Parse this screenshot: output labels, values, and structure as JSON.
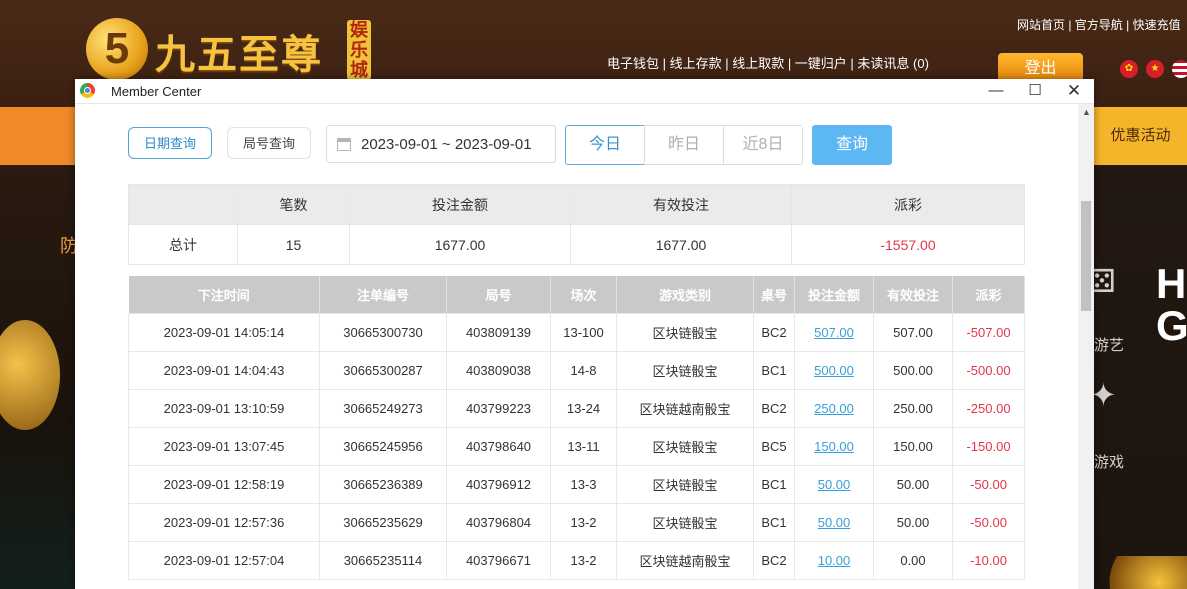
{
  "site": {
    "logo_number": "5",
    "logo_text": "九五至尊",
    "logo_tag": "娱乐城",
    "top_links": "网站首页 | 官方导航 | 快速充值",
    "wallet_links": "电子钱包 | 线上存款 | 线上取款 | 一键归户 | 未读讯息 (0)",
    "logout_label": "登出",
    "promo_label": "优惠活动",
    "left_text": "防",
    "side_label_1": "游艺",
    "side_label_2": "游戏",
    "side_big": "HO GA"
  },
  "window": {
    "title": "Member Center",
    "min_label": "—",
    "max_label": "☐",
    "close_label": "✕"
  },
  "toolbar": {
    "tab_date": "日期查询",
    "tab_round": "局号查询",
    "date_range": "2023-09-01 ~ 2023-09-01",
    "quick_today": "今日",
    "quick_yesterday": "昨日",
    "quick_8days": "近8日",
    "query_label": "查询"
  },
  "summary": {
    "headers": [
      "",
      "笔数",
      "投注金额",
      "有效投注",
      "派彩"
    ],
    "row": {
      "label": "总计",
      "count": "15",
      "bet": "1677.00",
      "valid": "1677.00",
      "payout": "-1557.00"
    }
  },
  "detail": {
    "headers": [
      "下注时间",
      "注单编号",
      "局号",
      "场次",
      "游戏类别",
      "桌号",
      "投注金额",
      "有效投注",
      "派彩"
    ],
    "rows": [
      [
        "2023-09-01 14:05:14",
        "30665300730",
        "403809139",
        "13-100",
        "区块链骰宝",
        "BC2",
        "507.00",
        "507.00",
        "-507.00"
      ],
      [
        "2023-09-01 14:04:43",
        "30665300287",
        "403809038",
        "14-8",
        "区块链骰宝",
        "BC1",
        "500.00",
        "500.00",
        "-500.00"
      ],
      [
        "2023-09-01 13:10:59",
        "30665249273",
        "403799223",
        "13-24",
        "区块链越南骰宝",
        "BC2",
        "250.00",
        "250.00",
        "-250.00"
      ],
      [
        "2023-09-01 13:07:45",
        "30665245956",
        "403798640",
        "13-11",
        "区块链骰宝",
        "BC5",
        "150.00",
        "150.00",
        "-150.00"
      ],
      [
        "2023-09-01 12:58:19",
        "30665236389",
        "403796912",
        "13-3",
        "区块链骰宝",
        "BC1",
        "50.00",
        "50.00",
        "-50.00"
      ],
      [
        "2023-09-01 12:57:36",
        "30665235629",
        "403796804",
        "13-2",
        "区块链骰宝",
        "BC1",
        "50.00",
        "50.00",
        "-50.00"
      ],
      [
        "2023-09-01 12:57:04",
        "30665235114",
        "403796671",
        "13-2",
        "区块链越南骰宝",
        "BC2",
        "10.00",
        "0.00",
        "-10.00"
      ]
    ]
  },
  "colors": {
    "accent": "#5cb7f3",
    "negative": "#e0374a",
    "link": "#3a9fd8",
    "header_gray": "#c9c9c9"
  }
}
